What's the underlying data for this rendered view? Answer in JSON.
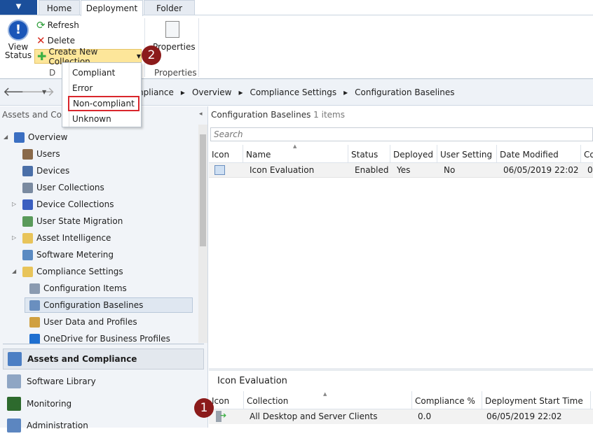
{
  "ribbon": {
    "tabs": [
      "Home",
      "Deployment",
      "Folder"
    ],
    "active_tab": "Deployment",
    "view_status": "View Status",
    "refresh": "Refresh",
    "delete": "Delete",
    "create_new_collection": "Create New Collection",
    "group_deployment": "D",
    "properties": "Properties",
    "group_properties": "Properties"
  },
  "dropdown": {
    "items": [
      "Compliant",
      "Error",
      "Non-compliant",
      "Unknown"
    ],
    "highlighted": "Non-compliant"
  },
  "breadcrumb": [
    "Assets and Compliance",
    "Overview",
    "Compliance Settings",
    "Configuration Baselines"
  ],
  "left": {
    "header": "Assets and Compliance",
    "tree": [
      {
        "label": "Overview",
        "level": 0,
        "expanded": true
      },
      {
        "label": "Users",
        "level": 1
      },
      {
        "label": "Devices",
        "level": 1
      },
      {
        "label": "User Collections",
        "level": 1
      },
      {
        "label": "Device Collections",
        "level": 1,
        "expandable": true
      },
      {
        "label": "User State Migration",
        "level": 1
      },
      {
        "label": "Asset Intelligence",
        "level": 1,
        "expandable": true
      },
      {
        "label": "Software Metering",
        "level": 1
      },
      {
        "label": "Compliance Settings",
        "level": 1,
        "expanded": true
      },
      {
        "label": "Configuration Items",
        "level": 2
      },
      {
        "label": "Configuration Baselines",
        "level": 2,
        "selected": true
      },
      {
        "label": "User Data and Profiles",
        "level": 2
      },
      {
        "label": "OneDrive for Business Profiles",
        "level": 2
      }
    ],
    "workspaces": [
      "Assets and Compliance",
      "Software Library",
      "Monitoring",
      "Administration"
    ]
  },
  "main": {
    "title": "Configuration Baselines",
    "count": "1 items",
    "search_placeholder": "Search",
    "columns": [
      "Icon",
      "Name",
      "Status",
      "Deployed",
      "User Setting",
      "Date Modified",
      "Co"
    ],
    "rows": [
      {
        "name": "Icon Evaluation",
        "status": "Enabled",
        "deployed": "Yes",
        "user_setting": "No",
        "date_modified": "06/05/2019 22:02",
        "co": "0"
      }
    ]
  },
  "detail": {
    "title": "Icon Evaluation",
    "columns": [
      "Icon",
      "Collection",
      "Compliance %",
      "Deployment Start Time"
    ],
    "rows": [
      {
        "collection": "All Desktop and Server Clients",
        "compliance": "0.0",
        "start": "06/05/2019 22:02"
      }
    ]
  },
  "badges": [
    "1",
    "2"
  ]
}
